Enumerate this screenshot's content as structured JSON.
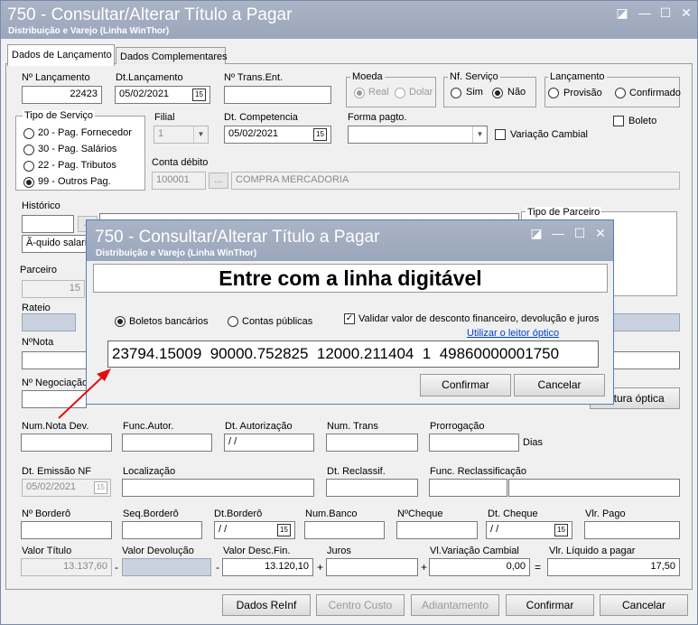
{
  "window": {
    "title": "750 - Consultar/Alterar Título a Pagar",
    "subtitle": "Distribuição e Varejo (Linha WinThor)",
    "controls": [
      "◪",
      "—",
      "☐",
      "✕"
    ]
  },
  "tabs": [
    "Dados de Lançamento",
    "Dados Complementares"
  ],
  "fields": {
    "n_lancamento": {
      "label": "Nº Lançamento",
      "value": "22423"
    },
    "dt_lancamento": {
      "label": "Dt.Lançamento",
      "value": "05/02/2021"
    },
    "n_trans_ent": {
      "label": "Nº Trans.Ent.",
      "value": ""
    },
    "filial": {
      "label": "Filial",
      "value": "1"
    },
    "dt_competencia": {
      "label": "Dt. Competencia",
      "value": "05/02/2021"
    },
    "forma_pagto": {
      "label": "Forma pagto.",
      "value": ""
    },
    "conta_debito": {
      "label": "Conta débito",
      "code": "100001",
      "desc": "COMPRA MERCADORIA",
      "btn": "..."
    },
    "historico": {
      "label": "Histórico",
      "value": "Ã-quido salaria"
    },
    "parceiro": {
      "label": "Parceiro",
      "value": "15"
    },
    "rateio": {
      "label": "Rateio"
    },
    "nnota": {
      "label": "NºNota"
    },
    "nnegociacao": {
      "label": "Nº Negociação"
    },
    "num_nota_dev": {
      "label": "Num.Nota Dev."
    },
    "func_autor": {
      "label": "Func.Autor."
    },
    "dt_autorizacao": {
      "label": "Dt. Autorização",
      "value": " / /"
    },
    "num_trans": {
      "label": "Num. Trans"
    },
    "prorrogacao": {
      "label": "Prorrogação",
      "suffix": "Dias"
    },
    "dt_emissao_nf": {
      "label": "Dt. Emissão NF",
      "value": "05/02/2021"
    },
    "localizacao": {
      "label": "Localização"
    },
    "dt_reclassif": {
      "label": "Dt. Reclassif."
    },
    "func_reclassificacao": {
      "label": "Func. Reclassificação"
    },
    "n_bordero": {
      "label": "Nº Borderô"
    },
    "seq_bordero": {
      "label": "Seq.Borderô"
    },
    "dt_bordero": {
      "label": "Dt.Borderô",
      "value": " / /"
    },
    "num_banco": {
      "label": "Num.Banco"
    },
    "n_cheque": {
      "label": "NºCheque"
    },
    "dt_cheque": {
      "label": "Dt. Cheque",
      "value": " / /"
    },
    "vlr_pago": {
      "label": "Vlr. Pago"
    },
    "valor_titulo": {
      "label": "Valor Título",
      "value": "13.137,60"
    },
    "valor_devolucao": {
      "label": "Valor Devolução"
    },
    "valor_desc_fin": {
      "label": "Valor Desc.Fin.",
      "value": "13.120,10"
    },
    "juros": {
      "label": "Juros"
    },
    "vl_variacao_cambial": {
      "label": "Vl.Variação Cambial",
      "value": "0,00"
    },
    "vlr_liquido": {
      "label": "Vlr. Líquido a pagar",
      "value": "17,50"
    }
  },
  "ops": {
    "minus1": "-",
    "minus2": "-",
    "plus1": "+",
    "plus2": "+",
    "equals": "="
  },
  "moeda": {
    "label": "Moeda",
    "options": [
      "Real",
      "Dolar"
    ],
    "selected": "Real"
  },
  "nf_servico": {
    "label": "Nf. Serviço",
    "options": [
      "Sim",
      "Não"
    ],
    "selected": "Não"
  },
  "lancamento": {
    "label": "Lançamento",
    "options": [
      "Provisão",
      "Confirmado"
    ]
  },
  "tipo_servico": {
    "label": "Tipo de Serviço",
    "options": [
      "20 - Pag. Fornecedor",
      "30 - Pag. Salários",
      "22 - Pag. Tributos",
      "99 - Outros Pag."
    ],
    "selected": "99 - Outros Pag."
  },
  "checks": {
    "boleto": "Boleto",
    "variacao_cambial": "Variação Cambial"
  },
  "tipo_parceiro": {
    "label": "Tipo de Parceiro"
  },
  "leitura_optica_btn": "eitura óptica",
  "buttons": {
    "dados_reinf": "Dados ReInf",
    "centro_custo": "Centro Custo",
    "adiantamento": "Adiantamento",
    "confirmar": "Confirmar",
    "cancelar": "Cancelar"
  },
  "dialog": {
    "title": "750 - Consultar/Alterar Título a Pagar",
    "subtitle": "Distribuição e Varejo (Linha WinThor)",
    "controls": [
      "◪",
      "—",
      "☐",
      "✕"
    ],
    "heading": "Entre com a linha digitável",
    "options": [
      "Boletos bancários",
      "Contas públicas"
    ],
    "selected": "Boletos bancários",
    "validar": "Validar valor de desconto financeiro,  devolução e juros",
    "leitor_link": "Utilizar o leitor óptico",
    "linha": "23794.15009  90000.752825  12000.211404  1  49860000001750",
    "confirmar": "Confirmar",
    "cancelar": "Cancelar"
  },
  "colors": {
    "titlebar": "#9aa6bb",
    "accent": "#e01010",
    "link": "#0044cc"
  }
}
